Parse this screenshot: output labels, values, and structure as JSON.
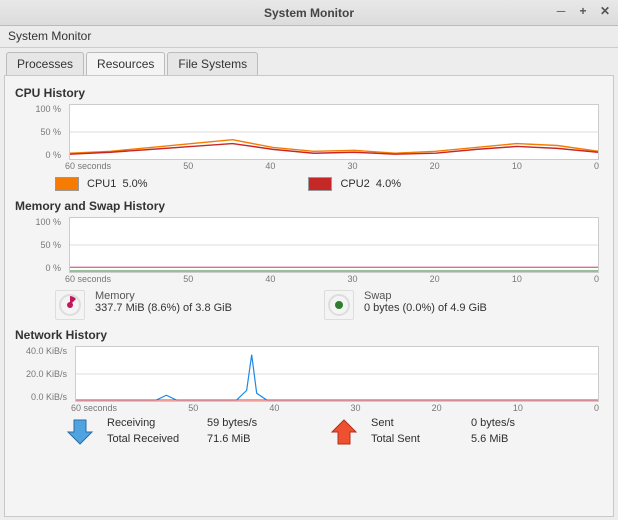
{
  "window": {
    "title": "System Monitor"
  },
  "menubar": {
    "label": "System Monitor"
  },
  "tabs": [
    {
      "label": "Processes",
      "active": false
    },
    {
      "label": "Resources",
      "active": true
    },
    {
      "label": "File Systems",
      "active": false
    }
  ],
  "cpu": {
    "title": "CPU History",
    "yticks": [
      "100 %",
      "50 %",
      "0 %"
    ],
    "xticks_label": "60 seconds",
    "xticks": [
      "50",
      "40",
      "30",
      "20",
      "10",
      "0"
    ],
    "legend": [
      {
        "name": "CPU1",
        "value": "5.0%",
        "color": "#f57c00"
      },
      {
        "name": "CPU2",
        "value": "4.0%",
        "color": "#c62828"
      }
    ]
  },
  "memory": {
    "title": "Memory and Swap History",
    "yticks": [
      "100 %",
      "50 %",
      "0 %"
    ],
    "xticks_label": "60 seconds",
    "xticks": [
      "50",
      "40",
      "30",
      "20",
      "10",
      "0"
    ],
    "items": [
      {
        "label": "Memory",
        "value": "337.7 MiB (8.6%) of 3.8 GiB"
      },
      {
        "label": "Swap",
        "value": "0 bytes (0.0%) of 4.9 GiB"
      }
    ]
  },
  "network": {
    "title": "Network History",
    "yticks": [
      "40.0 KiB/s",
      "20.0 KiB/s",
      "0.0 KiB/s"
    ],
    "xticks_label": "60 seconds",
    "xticks": [
      "50",
      "40",
      "30",
      "20",
      "10",
      "0"
    ],
    "receiving": {
      "label1": "Receiving",
      "value1": "59 bytes/s",
      "label2": "Total Received",
      "value2": "71.6 MiB"
    },
    "sending": {
      "label1": "Sent",
      "value1": "0 bytes/s",
      "label2": "Total Sent",
      "value2": "5.6 MiB"
    }
  },
  "chart_data": [
    {
      "type": "line",
      "title": "CPU History",
      "xlabel": "seconds",
      "ylabel": "%",
      "xlim": [
        0,
        60
      ],
      "ylim": [
        0,
        100
      ],
      "x": [
        60,
        55,
        50,
        45,
        40,
        35,
        30,
        25,
        20,
        15,
        10,
        5,
        0
      ],
      "series": [
        {
          "name": "CPU1",
          "color": "#f57c00",
          "values": [
            10,
            12,
            22,
            18,
            25,
            15,
            10,
            12,
            8,
            10,
            12,
            18,
            12
          ]
        },
        {
          "name": "CPU2",
          "color": "#c62828",
          "values": [
            8,
            10,
            18,
            15,
            20,
            12,
            8,
            10,
            7,
            8,
            10,
            15,
            10
          ]
        }
      ]
    },
    {
      "type": "line",
      "title": "Memory and Swap History",
      "xlabel": "seconds",
      "ylabel": "%",
      "xlim": [
        0,
        60
      ],
      "ylim": [
        0,
        100
      ],
      "x": [
        60,
        50,
        40,
        30,
        20,
        10,
        0
      ],
      "series": [
        {
          "name": "Memory",
          "color": "#c2185b",
          "values": [
            8.6,
            8.6,
            8.6,
            8.6,
            8.6,
            8.6,
            8.6
          ]
        },
        {
          "name": "Swap",
          "color": "#2e7d32",
          "values": [
            0,
            0,
            0,
            0,
            0,
            0,
            0
          ]
        }
      ]
    },
    {
      "type": "line",
      "title": "Network History",
      "xlabel": "seconds",
      "ylabel": "KiB/s",
      "xlim": [
        0,
        60
      ],
      "ylim": [
        0,
        40
      ],
      "x": [
        60,
        55,
        50,
        45,
        42,
        40,
        38,
        35,
        30,
        25,
        20,
        15,
        10,
        5,
        0
      ],
      "series": [
        {
          "name": "Receiving",
          "color": "#1e88e5",
          "values": [
            0,
            0,
            2,
            0,
            5,
            35,
            3,
            0,
            0,
            0,
            0,
            0,
            0,
            0,
            0
          ]
        },
        {
          "name": "Sent",
          "color": "#e53935",
          "values": [
            0,
            0,
            0,
            0,
            0,
            0,
            0,
            0,
            0,
            0,
            0,
            0,
            0,
            0,
            0
          ]
        }
      ]
    }
  ]
}
